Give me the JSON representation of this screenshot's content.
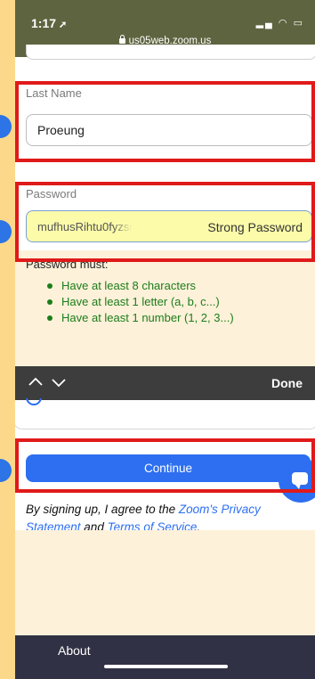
{
  "status_bar": {
    "time": "1:17",
    "url": "us05web.zoom.us"
  },
  "form": {
    "last_name": {
      "label": "Last Name",
      "value": "Proeung"
    },
    "password": {
      "label": "Password",
      "value": "mufhusRihtu0fyzsi",
      "strength": "Strong Password"
    }
  },
  "password_rules": {
    "title": "Password must:",
    "items": [
      "Have at least 8 characters",
      "Have at least 1 letter (a, b, c...)",
      "Have at least 1 number (1, 2, 3...)"
    ]
  },
  "keyboard_bar": {
    "done_label": "Done"
  },
  "continue_label": "Continue",
  "legal": {
    "prefix": "By signing up, I agree to the ",
    "privacy_link": "Zoom's Privacy Statement",
    "and": " and ",
    "terms_link": "Terms of Service",
    "suffix": "."
  },
  "footer": {
    "about_label": "About"
  },
  "icons": [
    "location-arrow-icon",
    "signal-icon",
    "wifi-icon",
    "battery-icon",
    "lock-icon",
    "chevron-up-icon",
    "chevron-down-icon",
    "chat-icon"
  ],
  "colors": {
    "accent": "#2d6ff0",
    "annotation": "#e01a1a",
    "requirement_green": "#1b7d1b"
  }
}
